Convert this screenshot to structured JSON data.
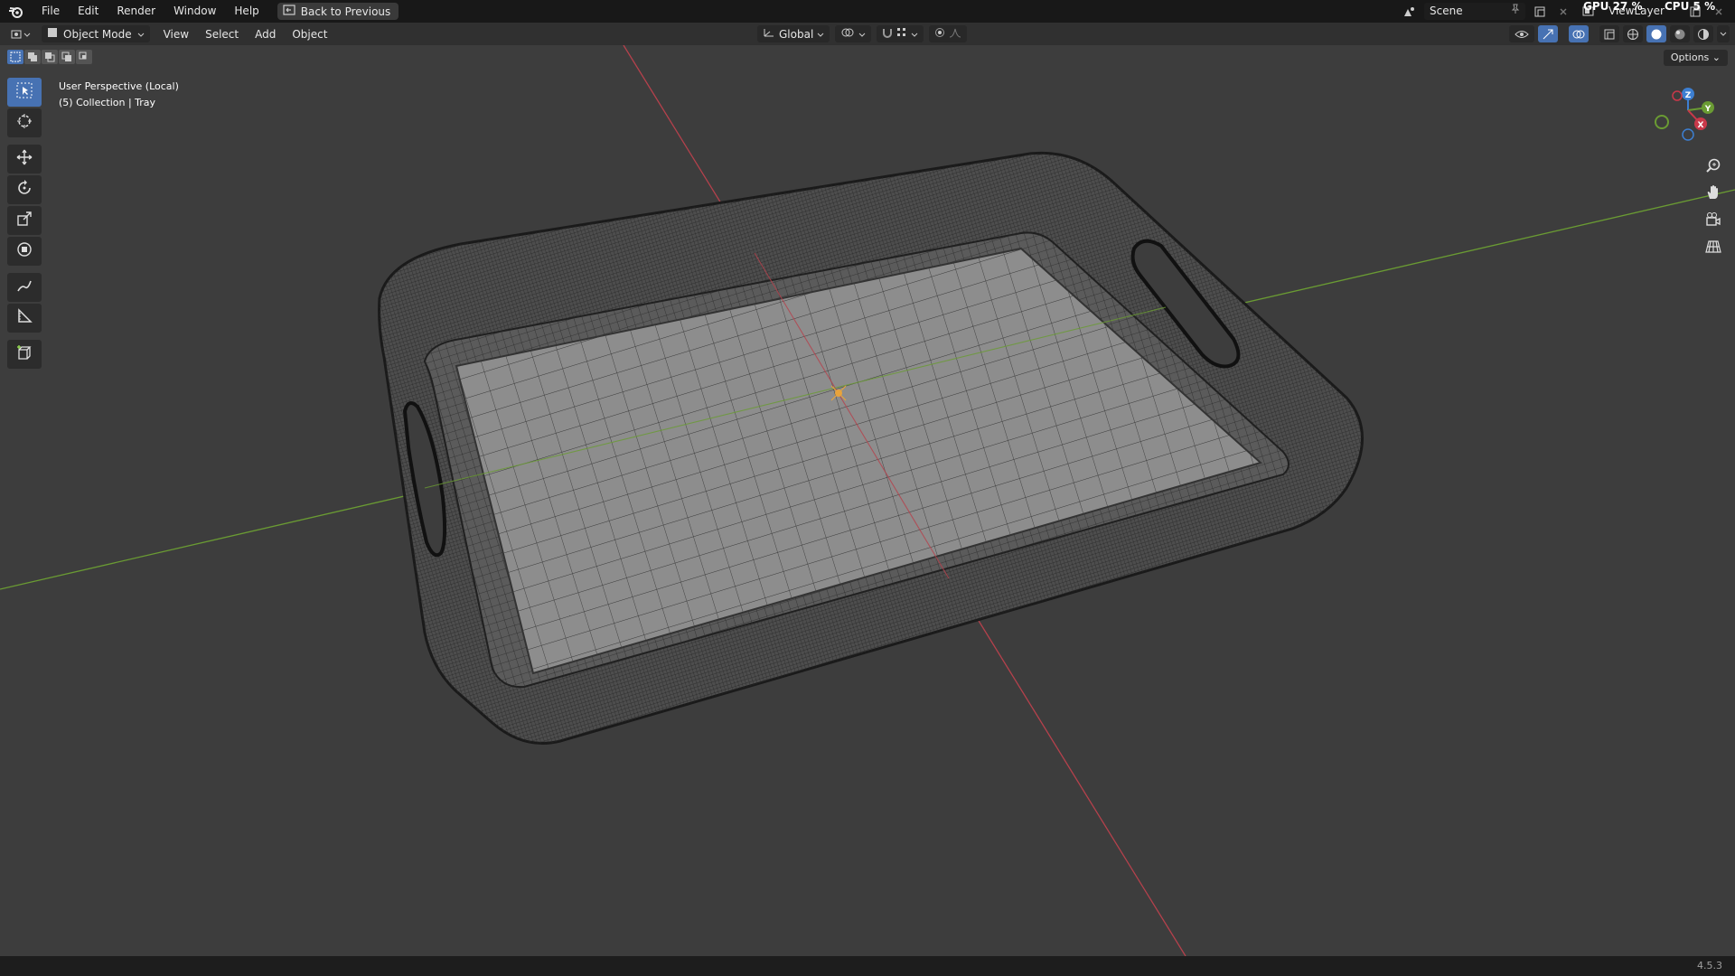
{
  "topbar": {
    "menus": [
      "File",
      "Edit",
      "Render",
      "Window",
      "Help"
    ],
    "back_button": "Back to Previous",
    "scene": "Scene",
    "view_layer": "ViewLayer",
    "gpu_label": "GPU",
    "gpu_value": "27 %",
    "cpu_label": "CPU",
    "cpu_value": "5 %"
  },
  "header": {
    "mode": "Object Mode",
    "menus": [
      "View",
      "Select",
      "Add",
      "Object"
    ],
    "transform_orientation": "Global",
    "options": "Options"
  },
  "viewport": {
    "perspective": "User Perspective (Local)",
    "collection": "(5) Collection | Tray",
    "object_name": "Tray",
    "axis_colors": {
      "x": "#b5414c",
      "y": "#6a9b33",
      "z": "#3d7fd1"
    }
  },
  "nav_gizmo": {
    "x_label": "X",
    "y_label": "Y",
    "z_label": "Z"
  },
  "status": {
    "version": "4.5.3"
  },
  "colors": {
    "accent": "#4772b3",
    "background": "#3d3d3d"
  }
}
